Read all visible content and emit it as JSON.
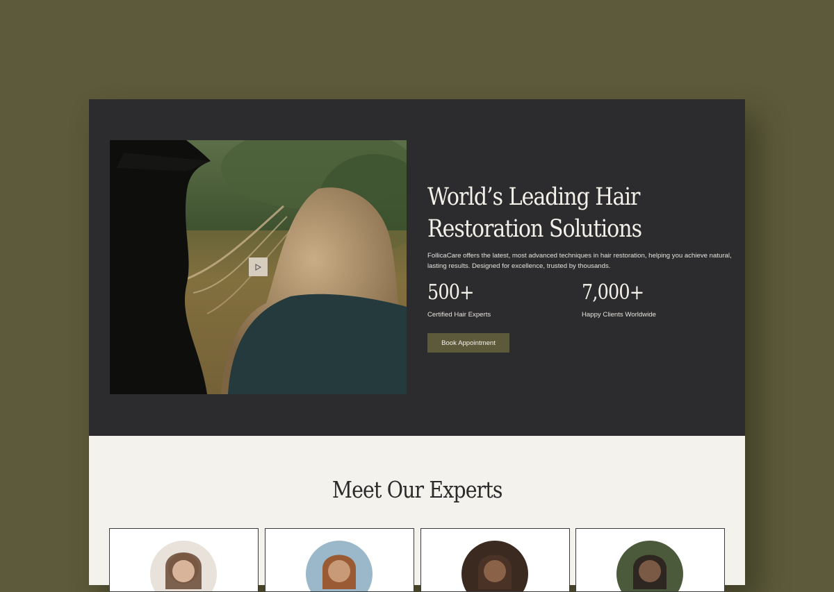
{
  "hero": {
    "title": "World’s Leading Hair Restoration Solutions",
    "description": "FollicaCare offers the latest, most advanced techniques in hair restoration, helping you achieve natural, lasting results. Designed for excellence, trusted by thousands.",
    "stats": [
      {
        "value": "500+",
        "label": "Certified Hair Experts"
      },
      {
        "value": "7,000+",
        "label": "Happy Clients Worldwide"
      }
    ],
    "cta_label": "Book Appointment",
    "video": {
      "play_icon": "play-icon"
    }
  },
  "experts": {
    "title": "Meet Our Experts",
    "cards": [
      {
        "avatar_tone": "#c9a48c",
        "bg_tone": "#e8e2da"
      },
      {
        "avatar_tone": "#b07a52",
        "bg_tone": "#9ab8c9"
      },
      {
        "avatar_tone": "#6b4a35",
        "bg_tone": "#3a2a20"
      },
      {
        "avatar_tone": "#5a4030",
        "bg_tone": "#4b5a3a"
      }
    ]
  },
  "colors": {
    "page_bg": "#5c5a3a",
    "hero_bg": "#2c2c2e",
    "accent": "#5c5a3a",
    "section_bg": "#f4f2ed"
  }
}
